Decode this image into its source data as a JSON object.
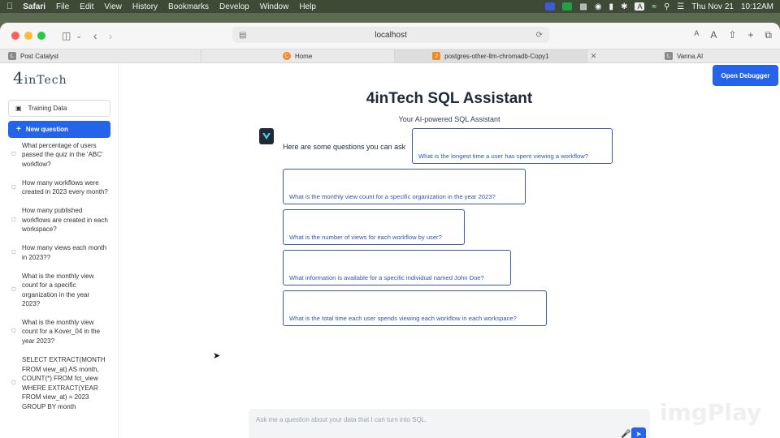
{
  "menubar": {
    "app": "Safari",
    "items": [
      "File",
      "Edit",
      "View",
      "History",
      "Bookmarks",
      "Develop",
      "Window",
      "Help"
    ],
    "status": {
      "date": "Thu Nov 21",
      "time": "10:12AM",
      "input": "A"
    }
  },
  "browser": {
    "url": "localhost",
    "tabs": [
      {
        "label": "Post Catalyst",
        "favicon": "L"
      },
      {
        "label": "Home",
        "favicon": "C"
      },
      {
        "label": "postgres-other-llm-chromadb-Copy1",
        "favicon": "J"
      },
      {
        "label": "Vanna.AI",
        "favicon": "L"
      }
    ]
  },
  "sidebar": {
    "logo_num": "4",
    "logo_text": "inTech",
    "training_label": "Training Data",
    "new_question_label": "New question",
    "history": [
      "What percentage of users passed the quiz in the 'ABC' workflow?",
      "How many workflows were created in 2023 every month?",
      "How many published workflows are created in each workspace?",
      "How many views each month in 2023??",
      "What is the monthly view count for a specific organization in the year 2023?",
      "What is the monthly view count for a Kover_04 in the year 2023?",
      "SELECT EXTRACT(MONTH FROM view_at) AS month, COUNT(*) FROM fct_view WHERE EXTRACT(YEAR FROM view_at) = 2023 GROUP BY month"
    ]
  },
  "main": {
    "debugger_label": "Open Debugger",
    "title": "4inTech SQL Assistant",
    "subtitle": "Your AI-powered SQL Assistant",
    "intro": "Here are some questions you can ask",
    "questions": [
      "What is the longest time a user has spent viewing a workflow?",
      "What is the monthly view count for a specific organization in the year 2023?",
      "What is the number of views for each workflow by user?",
      "What information is available for a specific individual named John Doe?",
      "What is the total time each user spends viewing each workflow in each workspace?"
    ],
    "chat_placeholder": "Ask me a question about your data that I can turn into SQL."
  },
  "watermark": "imgPlay",
  "colors": {
    "accent": "#2563eb",
    "question_border": "#3b5ba9",
    "question_text": "#2f56b0"
  }
}
